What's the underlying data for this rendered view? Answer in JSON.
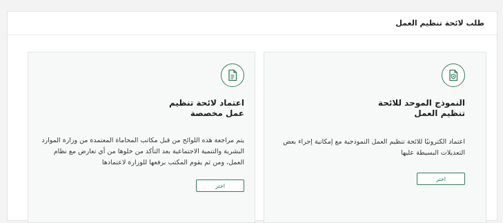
{
  "page": {
    "title": "طلب لائحة تنظيم العمل"
  },
  "colors": {
    "accent": "#2d7d5a",
    "card_bg": "#f7f9f8",
    "page_bg": "#f3f3f3"
  },
  "cards": [
    {
      "icon": "shield-document-icon",
      "title_line1": "النموذج الموحد للائحة",
      "title_line2": "تنظيم العمل",
      "description": "اعتماد الكترونيًا للائحة تنظيم العمل النموذجية مع إمكانية إجراء بعض التعديلات البسيطة عليها",
      "button_label": "اختر"
    },
    {
      "icon": "document-lines-icon",
      "title_line1": "اعتماد لائحة تنظيم",
      "title_line2": "عمل مخصصة",
      "description": "يتم مراجعة هذه اللوائح من قبل مكاتب المحاماة المعتمدة من وزارة الموارد البشرية والتنمية الاجتماعية بعد التأكد من خلوها من أي تعارض مع نظام العمل، ومن ثم يقوم المكتب برفعها للوزارة لاعتمادها",
      "button_label": "اختر"
    }
  ]
}
